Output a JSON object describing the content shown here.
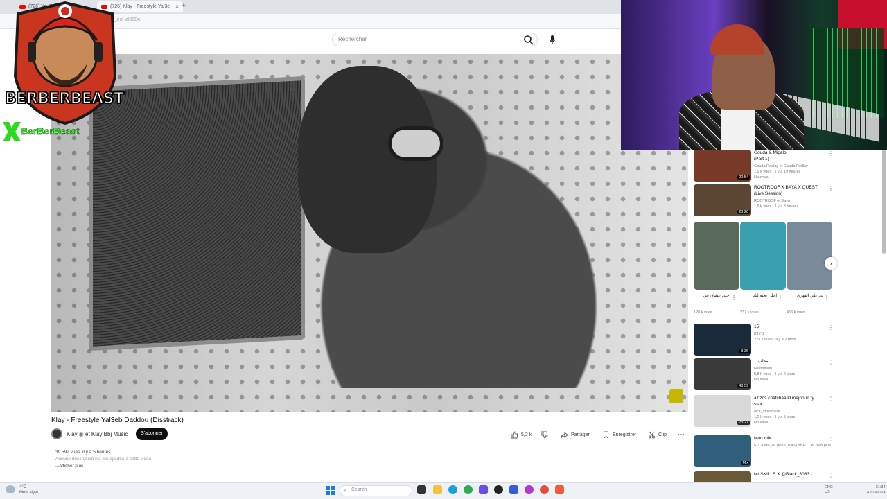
{
  "browser": {
    "tabs": [
      {
        "label": "(726) YouTube"
      },
      {
        "label": "(726) Klay - Freestyle Yal3e"
      }
    ],
    "url": "...Rb_ecHaH8Dc"
  },
  "youtube": {
    "search": {
      "placeholder": "Rechercher"
    },
    "video": {
      "title": "Klay - Freestyle Yal3eb Daddou (Disstrack)",
      "channel": "Klay",
      "collab": "et Klay Bbj Music",
      "subscribe_label": "S'abonner",
      "likes": "5,2 k",
      "share_label": "Partager",
      "save_label": "Enregistrer",
      "clip_label": "Clip",
      "views": "39 592 vues",
      "age": "il y a 5 heures",
      "description": "Aucune description n'a été ajoutée à cette vidéo.",
      "more_label": "...afficher plus"
    },
    "recommendations": [
      {
        "title": "Gouda & Migalo",
        "title2": "(Part 1)",
        "channel": "Gouda Redlay et Gouda Redlay",
        "stats": "1,9 k vues · il y a 19 heures",
        "badge": "Nouveau",
        "duration": "20:54",
        "color": "#7a3a2a"
      },
      {
        "title": "ROOTROOF X BAYA X QUEST",
        "title2": "(Live Session)",
        "channel": "ROOTROOF et Baya",
        "stats": "1,9 k vues · il y a 8 heures",
        "badge": "",
        "duration": "23:20",
        "color": "#5a4632"
      },
      {
        "title": "15",
        "title2": "",
        "channel": "KTYB",
        "stats": "223 k vues · il y a 2 mois",
        "badge": "",
        "duration": "3:36",
        "color": "#1b2a3a"
      },
      {
        "title": "...مقلب",
        "title2": "",
        "channel": "Nesthesuti",
        "stats": "5,8 k vues · il y a 2 jours",
        "badge": "Nouveau",
        "duration": "48:59",
        "color": "#3a3a3a"
      },
      {
        "title": "azizos chafchaa kl majnoun fy",
        "title2": "sfax",
        "channel": "eick_streamers",
        "stats": "1,2 k vues · il y a 5 jours",
        "badge": "Nouveau",
        "duration": "23:27",
        "color": "#d9d9d9"
      },
      {
        "title": "Mon mix",
        "title2": "",
        "channel": "El Castro, NOXVO, NASTYBHTT et bien plus",
        "stats": "",
        "badge": "",
        "duration": "Mix",
        "color": "#2f5f7a"
      },
      {
        "title": "Mr SKILLS X @Black_3083 -",
        "title2": "",
        "channel": "",
        "stats": "",
        "badge": "",
        "duration": "",
        "color": "#6a5a3a"
      }
    ],
    "shorts": [
      {
        "title": "احلى عشاق في",
        "views": "120 k vues",
        "color": "#5a6a5a"
      },
      {
        "title": "احلى تحية لبابا",
        "views": "237 k vues",
        "color": "#3aa0b0"
      },
      {
        "title": "بي علي الفهري",
        "views": "456 k vues",
        "color": "#7a8a9a"
      }
    ]
  },
  "overlay": {
    "logo_text": "BERBERBEAST",
    "logo_sub": "BerBerBeast"
  },
  "taskbar": {
    "weather": "4°C",
    "weather2": "Mesl alyet",
    "search": "Search",
    "lang": "ENG",
    "lang2": "US",
    "time": "21:34",
    "date": "20/03/2024"
  }
}
